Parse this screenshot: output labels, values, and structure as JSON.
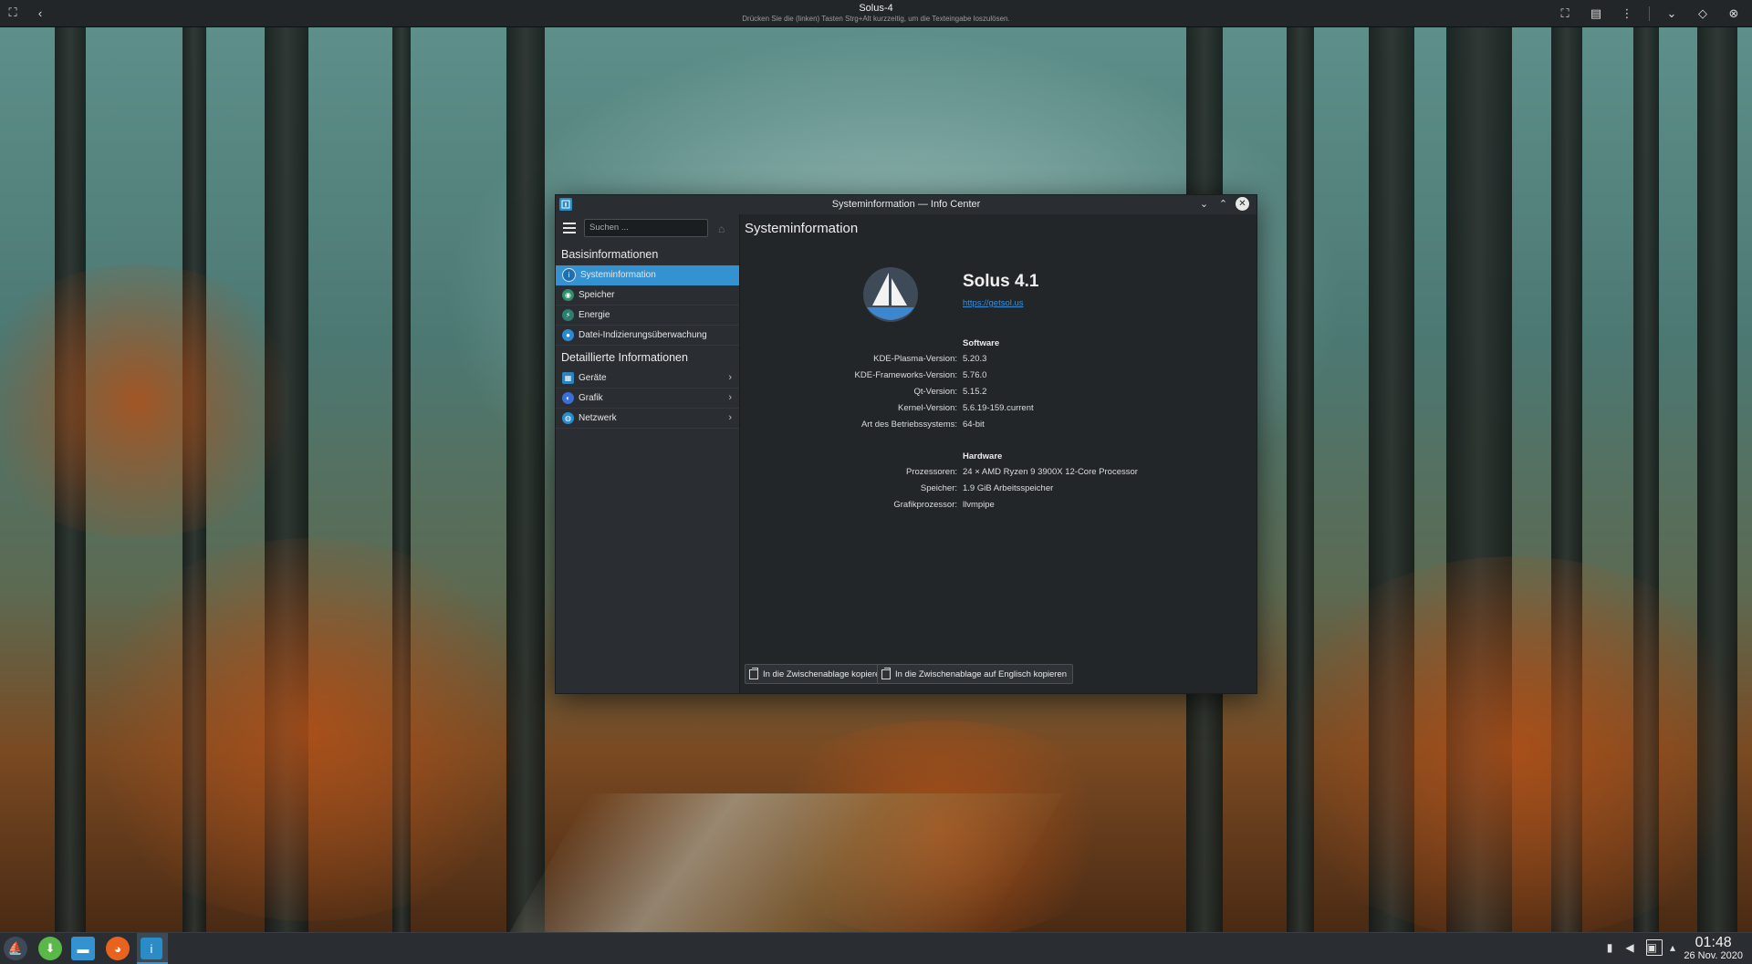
{
  "viewer": {
    "title": "Solus-4",
    "hint": "Drücken Sie die (linken) Tasten Strg+Alt kurzzeitig, um die Texteingabe loszulösen."
  },
  "window": {
    "title": "Systeminformation — Info Center"
  },
  "sidebar": {
    "search_placeholder": "Suchen ...",
    "section_basic": "Basisinformationen",
    "section_detailed": "Detaillierte Informationen",
    "items": [
      {
        "label": "Systeminformation",
        "icon": "info-icon",
        "selected": true
      },
      {
        "label": "Speicher",
        "icon": "memory-icon"
      },
      {
        "label": "Energie",
        "icon": "energy-icon"
      },
      {
        "label": "Datei-Indizierungsüberwachung",
        "icon": "file-indexer-icon"
      }
    ],
    "detailed_items": [
      {
        "label": "Geräte",
        "icon": "devices-icon"
      },
      {
        "label": "Grafik",
        "icon": "graphics-icon"
      },
      {
        "label": "Netzwerk",
        "icon": "network-icon"
      }
    ]
  },
  "content": {
    "page_title": "Systeminformation",
    "os_name": "Solus 4.1",
    "os_url": "https://getsol.us",
    "software_title": "Software",
    "software": [
      {
        "label": "KDE-Plasma-Version:",
        "value": "5.20.3"
      },
      {
        "label": "KDE-Frameworks-Version:",
        "value": "5.76.0"
      },
      {
        "label": "Qt-Version:",
        "value": "5.15.2"
      },
      {
        "label": "Kernel-Version:",
        "value": "5.6.19-159.current"
      },
      {
        "label": "Art des Betriebssystems:",
        "value": "64-bit"
      }
    ],
    "hardware_title": "Hardware",
    "hardware": [
      {
        "label": "Prozessoren:",
        "value": "24 × AMD Ryzen 9 3900X 12-Core Processor"
      },
      {
        "label": "Speicher:",
        "value": "1.9 GiB Arbeitsspeicher"
      },
      {
        "label": "Grafikprozessor:",
        "value": "llvmpipe"
      }
    ],
    "copy_button": "In die Zwischenablage kopieren",
    "copy_english_button": "In die Zwischenablage auf Englisch kopieren"
  },
  "taskbar": {
    "time": "01:48",
    "date": "26 Nov. 2020"
  },
  "colors": {
    "accent": "#3592d0",
    "window_bg": "#232629",
    "sidebar_bg": "#2a2e32",
    "link": "#3c8fd6"
  }
}
